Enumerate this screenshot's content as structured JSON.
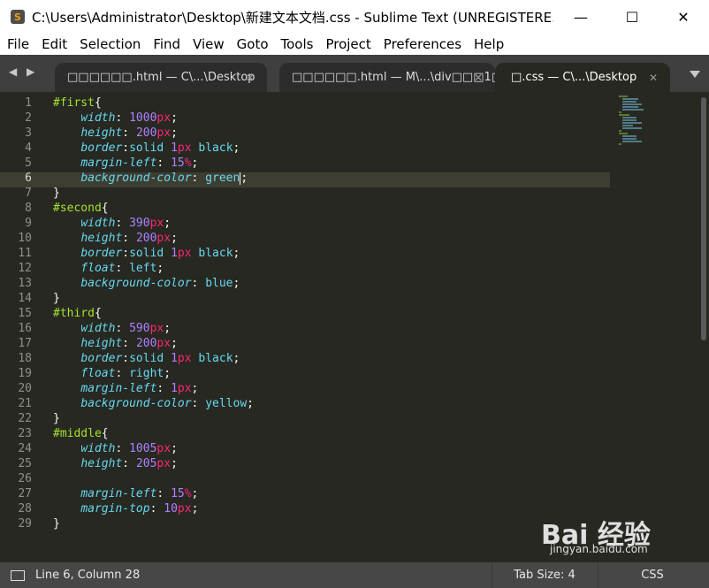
{
  "titlebar": {
    "icon": "sublime-text-icon",
    "icon_glyph": "S",
    "title": "C:\\Users\\Administrator\\Desktop\\新建文本文档.css - Sublime Text (UNREGISTERE...",
    "minimize_glyph": "—",
    "maximize_glyph": "☐",
    "close_glyph": "✕"
  },
  "menu": {
    "items": [
      "File",
      "Edit",
      "Selection",
      "Find",
      "View",
      "Goto",
      "Tools",
      "Project",
      "Preferences",
      "Help"
    ]
  },
  "tabs": {
    "nav_left": "◀",
    "nav_right": "▶",
    "items": [
      {
        "label": "□□□□□□.html — C\\...\\Desktop",
        "close": "✕",
        "active": false
      },
      {
        "label": "□□□□□□.html — M\\...\\div□□□1□",
        "close": "✕",
        "active": false
      },
      {
        "label": "□.css — C\\...\\Desktop",
        "close": "✕",
        "active": true
      }
    ]
  },
  "editor": {
    "line_numbers": [
      "1",
      "2",
      "3",
      "4",
      "5",
      "6",
      "7",
      "8",
      "9",
      "10",
      "11",
      "12",
      "13",
      "14",
      "15",
      "16",
      "17",
      "18",
      "19",
      "20",
      "21",
      "22",
      "23",
      "24",
      "25",
      "26",
      "27",
      "28",
      "29"
    ],
    "current_line": 6,
    "colors": {
      "background": "#272822",
      "selector": "#a6e22e",
      "property": "#66d9ef",
      "number": "#ae81ff",
      "unit": "#f92672",
      "text": "#f8f8f2"
    }
  },
  "code": {
    "l1_sel": "#first",
    "l1_brace": "{",
    "l2_prop": "width",
    "l2_num": "1000",
    "l2_unit": "px",
    "l3_prop": "height",
    "l3_num": "200",
    "l3_unit": "px",
    "l4_prop": "border",
    "l4_val1": "solid ",
    "l4_num": "1",
    "l4_unit": "px",
    "l4_val2": " black",
    "l5_prop": "margin-left",
    "l5_num": "15",
    "l5_unit": "%",
    "l6_prop": "background-color",
    "l6_val": "green",
    "l7_brace": "}",
    "l8_sel": "#second",
    "l8_brace": "{",
    "l9_prop": "width",
    "l9_num": "390",
    "l9_unit": "px",
    "l10_prop": "height",
    "l10_num": "200",
    "l10_unit": "px",
    "l11_prop": "border",
    "l11_val1": "solid ",
    "l11_num": "1",
    "l11_unit": "px",
    "l11_val2": " black",
    "l12_prop": "float",
    "l12_val": "left",
    "l13_prop": "background-color",
    "l13_val": "blue",
    "l14_brace": "}",
    "l15_sel": "#third",
    "l15_brace": "{",
    "l16_prop": "width",
    "l16_num": "590",
    "l16_unit": "px",
    "l17_prop": "height",
    "l17_num": "200",
    "l17_unit": "px",
    "l18_prop": "border",
    "l18_val1": "solid ",
    "l18_num": "1",
    "l18_unit": "px",
    "l18_val2": " black",
    "l19_prop": "float",
    "l19_val": "right",
    "l20_prop": "margin-left",
    "l20_num": "1",
    "l20_unit": "px",
    "l21_prop": "background-color",
    "l21_val": "yellow",
    "l22_brace": "}",
    "l23_sel": "#middle",
    "l23_brace": "{",
    "l24_prop": "width",
    "l24_num": "1005",
    "l24_unit": "px",
    "l25_prop": "height",
    "l25_num": "205",
    "l25_unit": "px",
    "l27_prop": "margin-left",
    "l27_num": "15",
    "l27_unit": "%",
    "l28_prop": "margin-top",
    "l28_num": "10",
    "l28_unit": "px",
    "l29_brace": "}"
  },
  "statusbar": {
    "position": "Line 6, Column 28",
    "tab_size": "Tab Size: 4",
    "syntax": "CSS"
  },
  "watermark": {
    "text": "Bai 经验",
    "sub": "jingyan.baidu.com"
  }
}
